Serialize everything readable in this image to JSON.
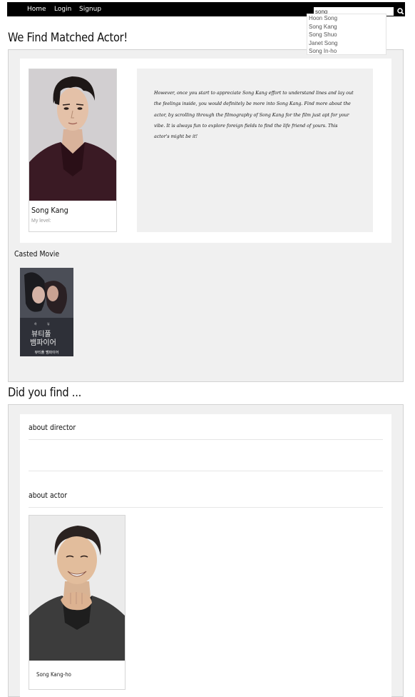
{
  "nav": {
    "links": [
      "Home",
      "Login",
      "Signup"
    ],
    "search_value": "song",
    "search_icon": "magnifier-icon",
    "suggestions": [
      "Hoon Song",
      "Song Kang",
      "Song Shuo",
      "Janet Song",
      "Song In-ho"
    ]
  },
  "match": {
    "title": "We Find Matched Actor!",
    "actor_name": "Song Kang",
    "level_label": "My level:",
    "description": "However, once you start to appreciate Song Kang effort to understand lines and lay out the feelings inside, you would definitely be more into Song Kang. Find more about the actor, by scrolling through the filmography of Song Kang for the film just apt for your vibe. It is always fun to explore foreign fields to find the life friend of yours. This actor's might be it!",
    "casted_label": "Casted Movie",
    "movie_caption": "뷰티풀 뱀파이어"
  },
  "did_you_find": {
    "title": "Did you find ...",
    "director_label": "about director",
    "actor_label": "about actor",
    "actor_name": "Song Kang-ho"
  },
  "colors": {
    "nav_bg": "#000000",
    "panel_bg": "#f0f0f0",
    "panel_border": "#d2d2d2"
  }
}
